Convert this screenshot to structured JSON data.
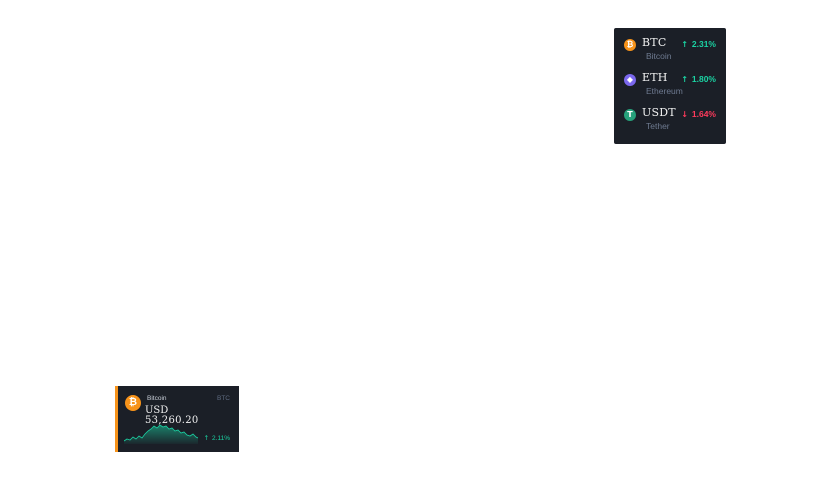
{
  "coin_list": {
    "items": [
      {
        "ticker": "BTC",
        "name": "Bitcoin",
        "change": "2.31%",
        "direction": "up",
        "icon": "bitcoin-icon",
        "icon_glyph": "₿",
        "color": "#f7931a"
      },
      {
        "ticker": "ETH",
        "name": "Ethereum",
        "change": "1.80%",
        "direction": "up",
        "icon": "ethereum-icon",
        "icon_glyph": "◆",
        "color": "#7b68ee"
      },
      {
        "ticker": "USDT",
        "name": "Tether",
        "change": "1.64%",
        "direction": "down",
        "icon": "tether-icon",
        "icon_glyph": "T",
        "color": "#26a17b"
      }
    ]
  },
  "price_card": {
    "name": "Bitcoin",
    "ticker": "BTC",
    "currency": "USD",
    "price": "53,260.20",
    "change": "2.11%",
    "direction": "up",
    "icon": "bitcoin-icon",
    "icon_glyph": "₿",
    "accent": "#f7931a"
  },
  "colors": {
    "up": "#1bd3a3",
    "down": "#ff3b5c",
    "panel_bg": "#1b1f27"
  }
}
